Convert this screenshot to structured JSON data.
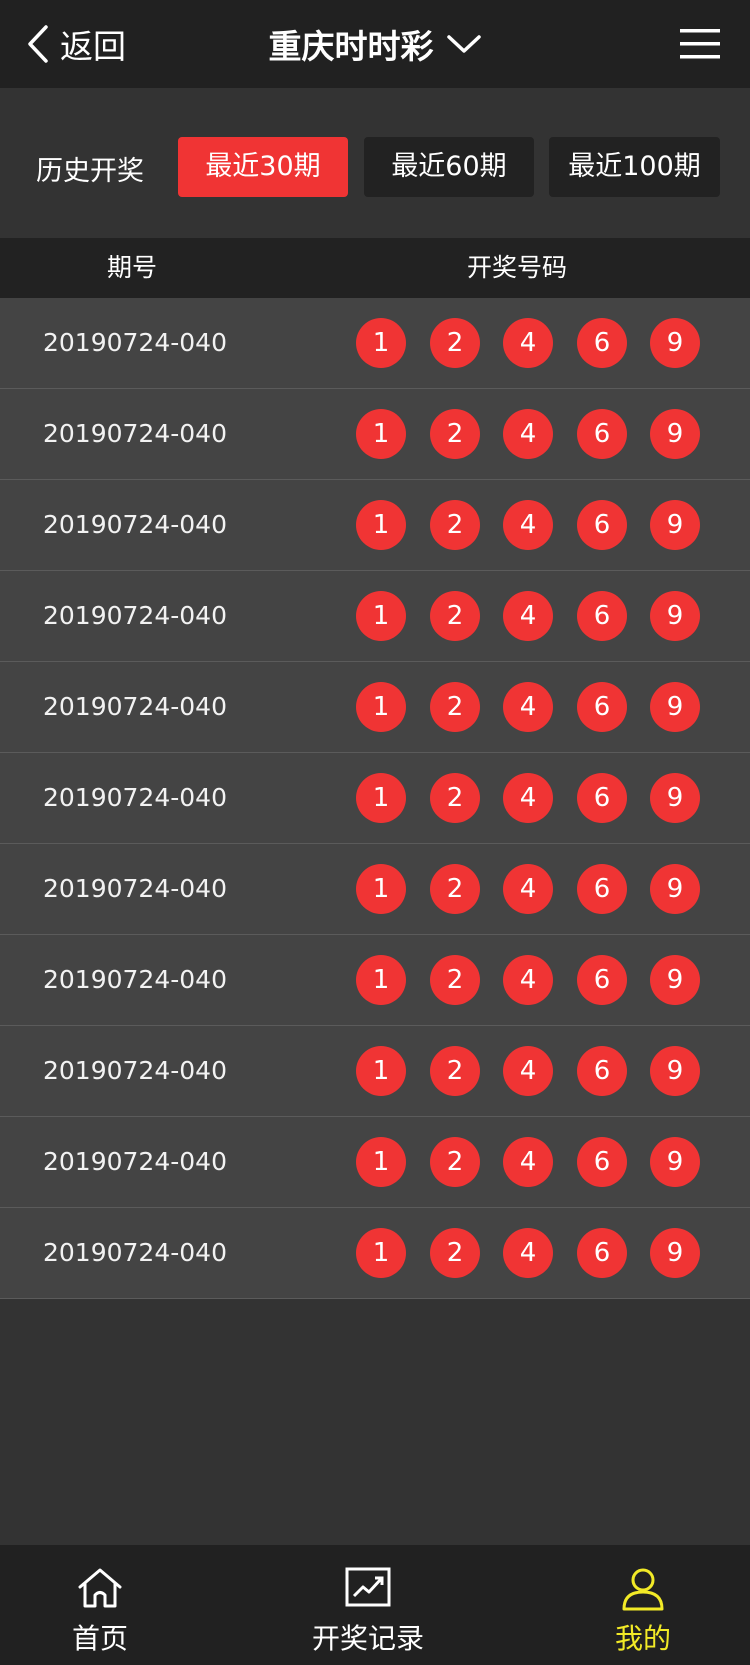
{
  "header": {
    "back_label": "返回",
    "title": "重庆时时彩"
  },
  "filter": {
    "label": "历史开奖",
    "options": [
      "最近30期",
      "最近60期",
      "最近100期"
    ],
    "selected": "最近30期"
  },
  "table": {
    "col_issue": "期号",
    "col_numbers": "开奖号码",
    "rows": [
      {
        "issue": "20190724-040",
        "numbers": [
          "1",
          "2",
          "4",
          "6",
          "9"
        ]
      },
      {
        "issue": "20190724-040",
        "numbers": [
          "1",
          "2",
          "4",
          "6",
          "9"
        ]
      },
      {
        "issue": "20190724-040",
        "numbers": [
          "1",
          "2",
          "4",
          "6",
          "9"
        ]
      },
      {
        "issue": "20190724-040",
        "numbers": [
          "1",
          "2",
          "4",
          "6",
          "9"
        ]
      },
      {
        "issue": "20190724-040",
        "numbers": [
          "1",
          "2",
          "4",
          "6",
          "9"
        ]
      },
      {
        "issue": "20190724-040",
        "numbers": [
          "1",
          "2",
          "4",
          "6",
          "9"
        ]
      },
      {
        "issue": "20190724-040",
        "numbers": [
          "1",
          "2",
          "4",
          "6",
          "9"
        ]
      },
      {
        "issue": "20190724-040",
        "numbers": [
          "1",
          "2",
          "4",
          "6",
          "9"
        ]
      },
      {
        "issue": "20190724-040",
        "numbers": [
          "1",
          "2",
          "4",
          "6",
          "9"
        ]
      },
      {
        "issue": "20190724-040",
        "numbers": [
          "1",
          "2",
          "4",
          "6",
          "9"
        ]
      },
      {
        "issue": "20190724-040",
        "numbers": [
          "1",
          "2",
          "4",
          "6",
          "9"
        ]
      }
    ]
  },
  "tabbar": {
    "items": [
      {
        "label": "首页",
        "icon": "home-icon"
      },
      {
        "label": "开奖记录",
        "icon": "trend-chart-icon"
      },
      {
        "label": "我的",
        "icon": "user-icon"
      }
    ],
    "active": "我的"
  },
  "colors": {
    "accent": "#f03434",
    "active_tab": "#f2ea27",
    "header_bg": "#212121",
    "row_bg": "#444444"
  }
}
